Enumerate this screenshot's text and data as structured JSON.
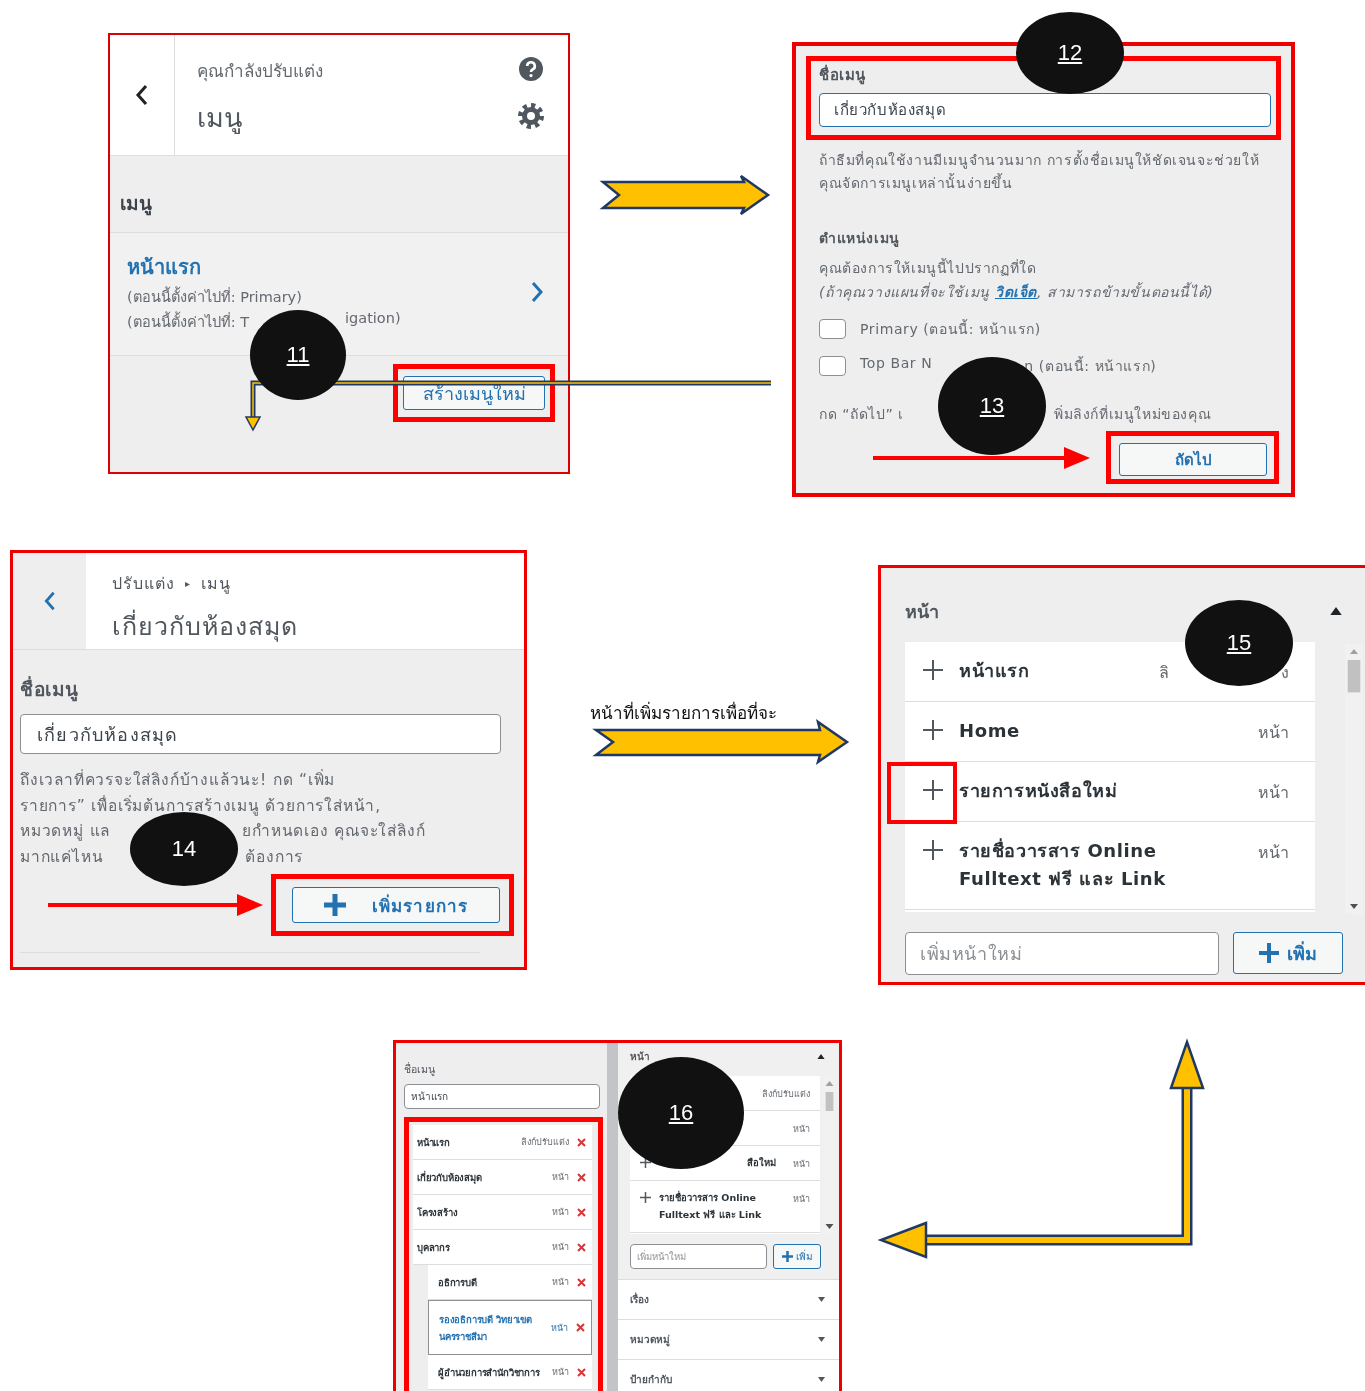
{
  "create_menu_screen": {
    "subtitle": "คุณกำลังปรับแต่ง",
    "title": "เมนู",
    "section_title": "เมนู",
    "menus": [
      {
        "name": "หน้าแรก",
        "location_lines": [
          [
            "(ตอนนี้ตั้งค่าไปที่: Primary)"
          ],
          [
            "(ตอนนี้ตั้งค่าไปที่: T",
            "igation)"
          ]
        ]
      }
    ],
    "create_button": "สร้างเมนูใหม่"
  },
  "menu_name_screen": {
    "name_label": "ชื่อเมนู",
    "name_value": "เกี่ยวกับห้องสมุด",
    "name_hint": "ถ้าธีมที่คุณใช้งานมีเมนูจำนวนมาก การตั้งชื่อเมนูให้ชัดเจนจะช่วยให้คุณจัดการเมนูเหล่านั้นง่ายขึ้น",
    "locations_title": "ตำแหน่งเมนู",
    "locations_question": "คุณต้องการให้เมนูนี้ไปปรากฏที่ใด",
    "locations_note": "(ถ้าคุณวางแผนที่จะใช้เมนู",
    "widgets_link": "วิดเจ็ต",
    "locations_note_end": ", สามารถข้ามขั้นตอนนี้ได้)",
    "locations": [
      {
        "label": [
          "Primary (ตอนนี้: หน้าแรก)"
        ],
        "checked": false
      },
      {
        "label": [
          "Top Bar N",
          "n (ตอนนี้: หน้าแรก)"
        ],
        "checked": false
      }
    ],
    "next_hint": [
      "กด “ถัดไป” เ",
      "พิ่มลิงก์ที่เมนูใหม่ของคุณ"
    ],
    "next_button": "ถัดไป"
  },
  "menu_edit_screen": {
    "breadcrumb": [
      "ปรับแต่ง",
      "▸",
      "เมนู"
    ],
    "title": "เกี่ยวกับห้องสมุด",
    "name_label": "ชื่อเมนู",
    "name_value": "เกี่ยวกับห้องสมุด",
    "hint_lines": [
      [
        "ถึงเวลาที่ควรจะใส่ลิงก์บ้างแล้วนะ! กด “เพิ่ม"
      ],
      [
        "รายการ” เพื่อเริ่มต้นการสร้างเมนู ด้วยการใส่หน้า,"
      ],
      [
        "หมวดหมู่ แล",
        "ยกำหนดเอง คุณจะใส่ลิงก์"
      ],
      [
        "มากแค่ไหน",
        "ต้องการ"
      ]
    ],
    "add_items_button": "เพิ่มรายการ"
  },
  "step_caption": "หน้าที่เพิ่มรายการเพื่อที่จะ",
  "pages_screen": {
    "title": "หน้า",
    "expanded": true,
    "pages": [
      {
        "title": "หน้าแรก",
        "type": [
          "ลิ",
          "ง"
        ]
      },
      {
        "title": "Home",
        "type": [
          "หน้า"
        ]
      },
      {
        "title": "รายการหนังสือใหม่",
        "type": [
          "หน้า"
        ]
      },
      {
        "title": "รายชื่อวารสาร Online Fulltext ฟรี และ Link",
        "type": [
          "หน้า"
        ]
      }
    ],
    "new_page_placeholder": "เพิ่มหน้าใหม่",
    "add_button": "เพิ่ม"
  },
  "menu_structure_screen": {
    "name_label": "ชื่อเมนู",
    "name_value": "หน้าแรก",
    "items": [
      {
        "title": "หน้าแรก",
        "type": "ลิงก์ปรับแต่ง",
        "selected": false
      },
      {
        "title": "เกี่ยวกับห้องสมุด",
        "type": "หน้า",
        "selected": false
      },
      {
        "title": "โครงสร้าง",
        "type": "หน้า",
        "selected": false
      },
      {
        "title": "บุคลากร",
        "type": "หน้า",
        "selected": false,
        "children": [
          {
            "title": "อธิการบดี",
            "type": "หน้า",
            "selected": false
          },
          {
            "title": "รองอธิการบดี วิทยาเขตนครราชสีมา",
            "type": "หน้า",
            "selected": true
          },
          {
            "title": "ผู้อำนวยการสำนักวิชาการ",
            "type": "หน้า",
            "selected": false
          }
        ]
      }
    ],
    "pages_title": "หน้า",
    "pages_expanded": true,
    "pages": [
      {
        "type": "ลิงก์ปรับแต่ง"
      },
      {
        "type": "หน้า"
      },
      {
        "title": "สือใหม่",
        "type": "หน้า"
      },
      {
        "title": "รายชื่อวารสาร Online Fulltext ฟรี และ Link",
        "type": "หน้า"
      }
    ],
    "new_page_placeholder": "เพิ่มหน้าใหม่",
    "add_button": "เพิ่ม",
    "sections": [
      {
        "title": "เรื่อง",
        "expanded": false
      },
      {
        "title": "หมวดหมู่",
        "expanded": false
      },
      {
        "title": "ป้ายกำกับ",
        "expanded": false
      }
    ]
  },
  "callouts": [
    {
      "label": "11",
      "underlined": true
    },
    {
      "label": "12",
      "underlined": true
    },
    {
      "label": "13",
      "underlined": true
    },
    {
      "label": "14",
      "underlined": false
    },
    {
      "label": "15",
      "underlined": true
    },
    {
      "label": "16",
      "underlined": true
    }
  ]
}
